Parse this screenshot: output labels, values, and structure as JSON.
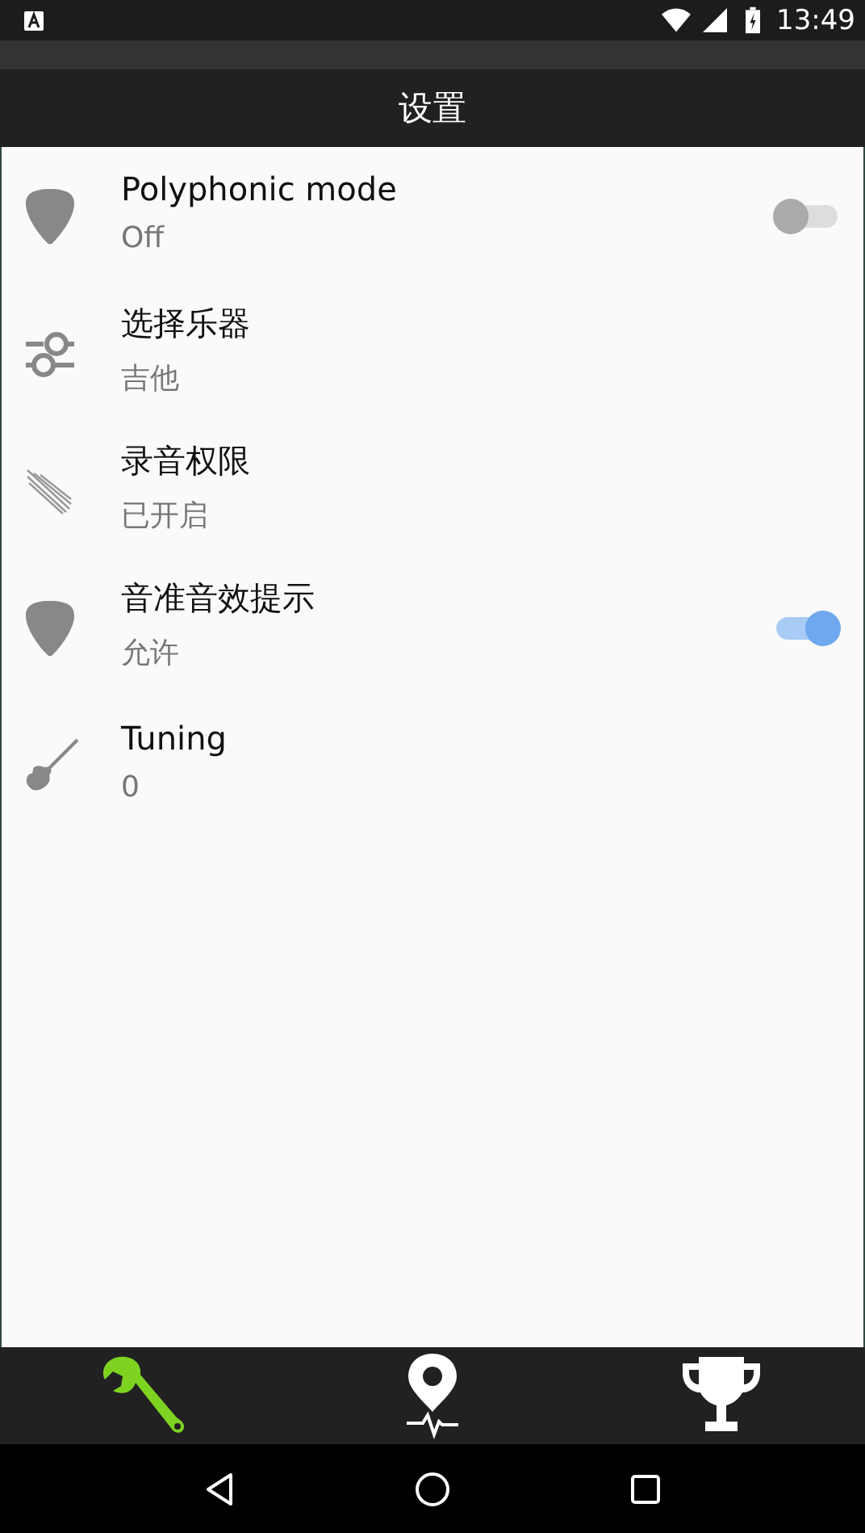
{
  "status_bar": {
    "time": "13:49"
  },
  "title": "设置",
  "settings": [
    {
      "title": "Polyphonic mode",
      "summary": "Off",
      "kind": "toggle",
      "on": false
    },
    {
      "title": "选择乐器",
      "summary": "吉他",
      "kind": "plain"
    },
    {
      "title": "录音权限",
      "summary": "已开启",
      "kind": "plain"
    },
    {
      "title": "音准音效提示",
      "summary": "允许",
      "kind": "toggle",
      "on": true
    },
    {
      "title": "Tuning",
      "summary": "0",
      "kind": "plain"
    }
  ],
  "bottom_tabs": [
    {
      "selected": true
    },
    {
      "selected": false
    },
    {
      "selected": false
    }
  ]
}
